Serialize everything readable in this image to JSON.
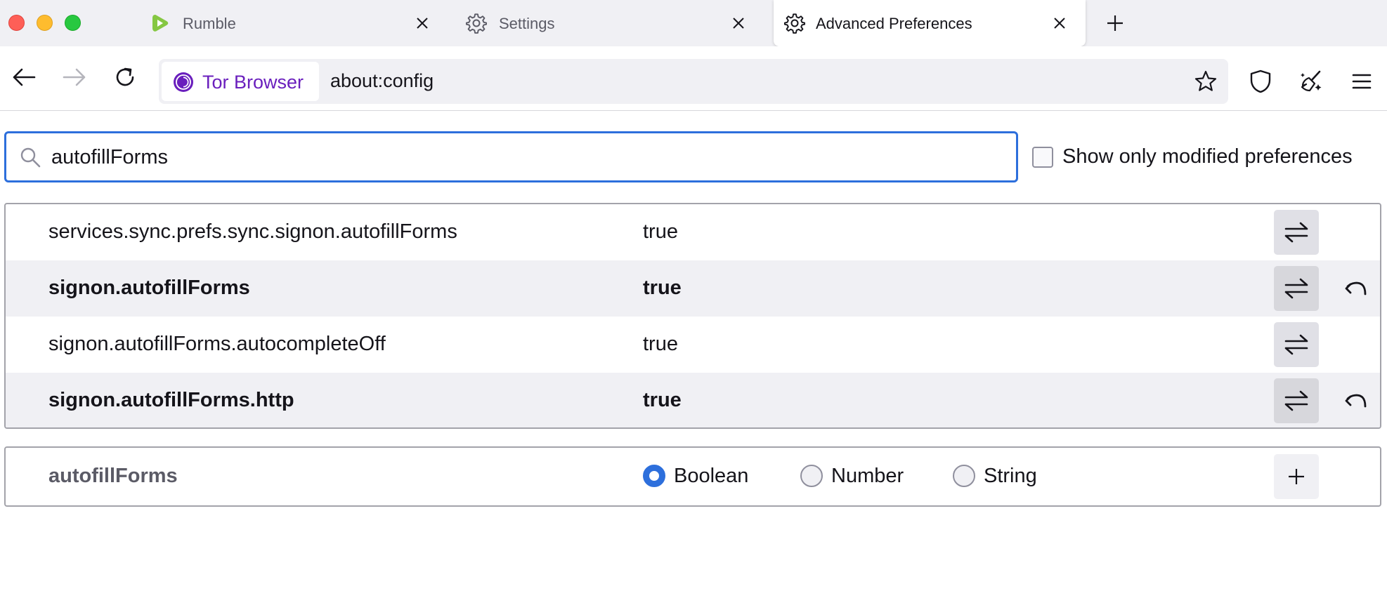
{
  "tabs": [
    {
      "title": "Rumble",
      "icon": "rumble-icon"
    },
    {
      "title": "Settings",
      "icon": "gear-icon"
    },
    {
      "title": "Advanced Preferences",
      "icon": "gear-icon",
      "active": true
    }
  ],
  "navbar": {
    "identity_label": "Tor Browser",
    "url": "about:config"
  },
  "search": {
    "value": "autofillForms"
  },
  "modified_toggle": {
    "label": "Show only modified preferences",
    "checked": false
  },
  "prefs": [
    {
      "name": "services.sync.prefs.sync.signon.autofillForms",
      "value": "true",
      "modified": false
    },
    {
      "name": "signon.autofillForms",
      "value": "true",
      "modified": true
    },
    {
      "name": "signon.autofillForms.autocompleteOff",
      "value": "true",
      "modified": false
    },
    {
      "name": "signon.autofillForms.http",
      "value": "true",
      "modified": true
    }
  ],
  "add_row": {
    "name": "autofillForms",
    "types": [
      {
        "label": "Boolean",
        "selected": true
      },
      {
        "label": "Number",
        "selected": false
      },
      {
        "label": "String",
        "selected": false
      }
    ]
  },
  "colors": {
    "accent": "#2d6fdc",
    "tor_purple": "#6a1fbd",
    "rumble_green": "#85c742"
  }
}
